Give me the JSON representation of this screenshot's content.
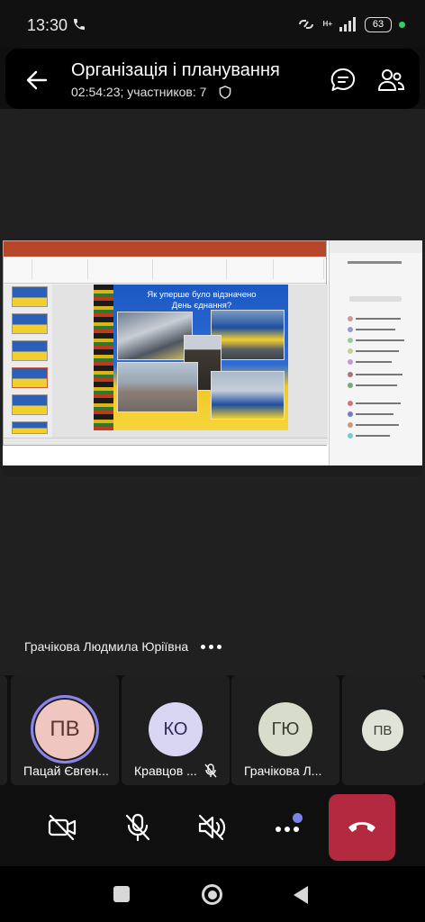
{
  "status_bar": {
    "time": "13:30",
    "network": "H+",
    "battery": "63"
  },
  "header": {
    "title": "Організація і планування",
    "duration": "02:54:23",
    "participants": "; участников: 7"
  },
  "shared_content": {
    "slide_title_line1": "Як уперше було відзначено",
    "slide_title_line2": "День єднання?"
  },
  "speaker": {
    "name": "Грачікова Людмила Юріївна"
  },
  "participants": [
    {
      "initials": "ПВ",
      "name": "Пацай Євген...",
      "color": "#f0c6c1",
      "speaking": true,
      "muted": false
    },
    {
      "initials": "КО",
      "name": "Кравцов ...",
      "color": "#d8d6f2",
      "speaking": false,
      "muted": true
    },
    {
      "initials": "ГЮ",
      "name": "Грачікова Л...",
      "color": "#d7dccb",
      "speaking": false,
      "muted": false
    },
    {
      "initials": "ПВ",
      "name": "",
      "color": "#dfe3d8",
      "speaking": false,
      "muted": false
    }
  ],
  "colors": {
    "hangup": "#b3293f",
    "accent": "#7b83eb",
    "speaking_ring": "#8a84ef"
  }
}
